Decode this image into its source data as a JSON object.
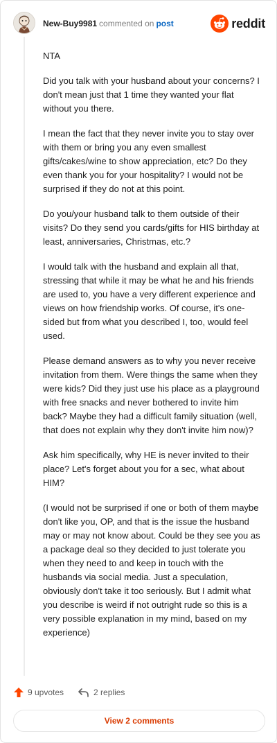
{
  "header": {
    "username": "New-Buy9981",
    "commented_on": "commented on",
    "post_link": "post",
    "brand": "reddit"
  },
  "comment": {
    "paragraphs": [
      "NTA",
      "Did you talk with your husband about your concerns? I don't mean just that 1 time they wanted your flat without you there.",
      "I mean the fact that they never invite you to stay over with them or bring you any even smallest gifts/cakes/wine to show appreciation, etc? Do they even thank you for your hospitality? I would not be surprised if they do not at this point.",
      "Do you/your husband talk to them outside of their visits? Do they send you cards/gifts for HIS birthday at least, anniversaries, Christmas, etc.?",
      "I would talk with the husband and explain all that, stressing that while it may be what he and his friends are used to, you have a very different experience and views on how friendship works. Of course, it's one-sided but from what you described I, too, would feel used.",
      "Please demand answers as to why you never receive invitation from them. Were things the same when they were kids? Did they just use his place as a playground with free snacks and never bothered to invite him back? Maybe they had a difficult family situation (well, that does not explain why they don't invite him now)?",
      "Ask him specifically, why HE is never invited to their place? Let's forget about you for a sec, what about HIM?",
      "(I would not be surprised if one or both of them maybe don't like you, OP, and that is the issue the husband may or may not know about. Could be they see you as a package deal so they decided to just tolerate you when they need to and keep in touch with the husbands via social media. Just a speculation, obviously don't take it too seriously. But I admit what you describe is weird if not outright rude so this is a very possible explanation in my mind, based on my experience)"
    ]
  },
  "actions": {
    "upvotes": "9 upvotes",
    "replies": "2 replies",
    "view_comments": "View 2 comments"
  },
  "colors": {
    "reddit_orange": "#ff4500",
    "link_blue": "#0b67c2",
    "view_button_text": "#d93a00"
  },
  "icons": {
    "avatar": "avatar",
    "brand_logo": "reddit-logo-icon",
    "upvote": "upvote-arrow-icon",
    "reply": "reply-arrow-icon"
  }
}
